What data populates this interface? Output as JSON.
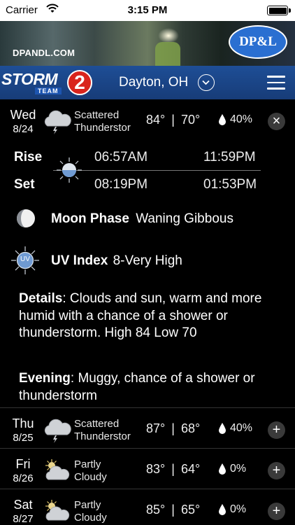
{
  "status_bar": {
    "carrier": "Carrier",
    "time": "3:15 PM"
  },
  "ad": {
    "site": "DPANDL.COM",
    "logo": "DP&L"
  },
  "nav": {
    "brand_word": "STORM",
    "brand_team": "TEAM",
    "brand_number": "2",
    "city": "Dayton, OH"
  },
  "today": {
    "dow": "Wed",
    "date": "8/24",
    "condition_line1": "Scattered",
    "condition_line2": "Thunderstor",
    "high": "84°",
    "sep": "|",
    "low": "70°",
    "precip": "40%",
    "close_label": "×",
    "icon": "thunderstorm-cloud-icon"
  },
  "sunmoon": {
    "rise_label": "Rise",
    "set_label": "Set",
    "sunrise": "06:57AM",
    "sunset": "08:19PM",
    "moonrise": "11:59PM",
    "moonset": "01:53PM"
  },
  "moon_phase": {
    "label": "Moon Phase",
    "value": "Waning Gibbous"
  },
  "uv": {
    "icon_text": "UV",
    "label": "UV Index",
    "value": "8-Very High"
  },
  "details": {
    "label": "Details",
    "text": ": Clouds and sun, warm and more humid with a chance of a shower or thunderstorm.  High 84 Low 70"
  },
  "evening": {
    "label": "Evening",
    "text": ": Muggy, chance of a shower or thunderstorm"
  },
  "forecast": [
    {
      "dow": "Thu",
      "date": "8/25",
      "condition_line1": "Scattered",
      "condition_line2": "Thunderstor",
      "high": "87°",
      "sep": "|",
      "low": "68°",
      "precip": "40%",
      "expand": "+",
      "icon": "thunderstorm-cloud-icon"
    },
    {
      "dow": "Fri",
      "date": "8/26",
      "condition_line1": "Partly",
      "condition_line2": "Cloudy",
      "high": "83°",
      "sep": "|",
      "low": "64°",
      "precip": "0%",
      "expand": "+",
      "icon": "partly-cloudy-icon"
    },
    {
      "dow": "Sat",
      "date": "8/27",
      "condition_line1": "Partly",
      "condition_line2": "Cloudy",
      "high": "85°",
      "sep": "|",
      "low": "65°",
      "precip": "0%",
      "expand": "+",
      "icon": "partly-cloudy-icon"
    }
  ],
  "colors": {
    "nav_blue": "#1e4e96",
    "brand_red": "#d9241c",
    "background": "#000000"
  }
}
